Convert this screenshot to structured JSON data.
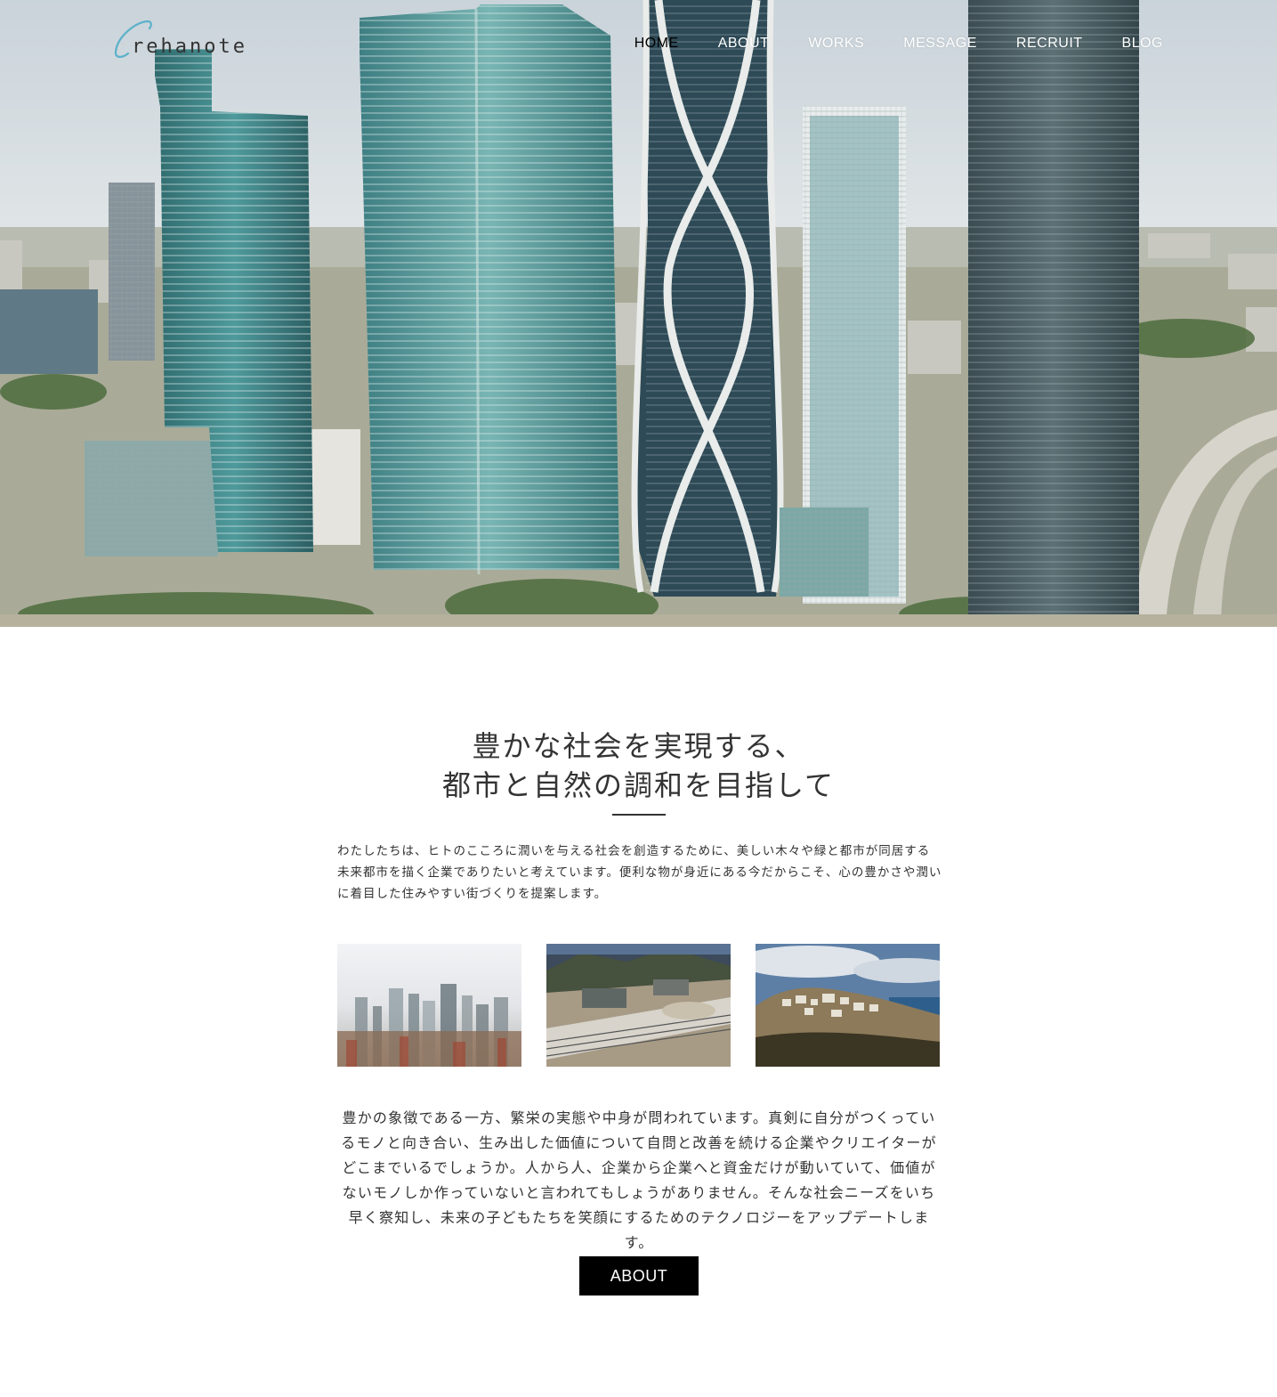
{
  "header": {
    "logo_text": "rehanote",
    "nav": [
      {
        "label": "HOME",
        "active": true
      },
      {
        "label": "ABOUT",
        "active": false
      },
      {
        "label": "WORKS",
        "active": false
      },
      {
        "label": "MESSAGE",
        "active": false
      },
      {
        "label": "RECRUIT",
        "active": false
      },
      {
        "label": "BLOG",
        "active": false
      }
    ]
  },
  "hero": {
    "image": "aerial-city-skyline"
  },
  "intro": {
    "headline_line1": "豊かな社会を実現する、",
    "headline_line2": "都市と自然の調和を目指して",
    "paragraph": "わたしたちは、ヒトのこころに潤いを与える社会を創造するために、美しい木々や緑と都市が同居する未来都市を描く企業でありたいと考えています。便利な物が身近にある今だからこそ、心の豊かさや潤いに着目した住みやすい街づくりを提案します。"
  },
  "gallery": [
    {
      "image": "foggy-city-skyline"
    },
    {
      "image": "industrial-rail-yard-mountains"
    },
    {
      "image": "hillside-coastal-village"
    }
  ],
  "body": {
    "paragraph": "豊かの象徴である一方、繁栄の実態や中身が問われています。真剣に自分がつくっているモノと向き合い、生み出した価値について自問と改善を続ける企業やクリエイターがどこまでいるでしょうか。人から人、企業から企業へと資金だけが動いていて、価値がないモノしか作っていないと言われてもしょうがありません。そんな社会ニーズをいち早く察知し、未来の子どもたちを笑顔にするためのテクノロジーをアップデートします。",
    "button_label": "ABOUT"
  },
  "colors": {
    "accent": "#000000",
    "text": "#333333",
    "logo_accent": "#5bb1c9"
  }
}
